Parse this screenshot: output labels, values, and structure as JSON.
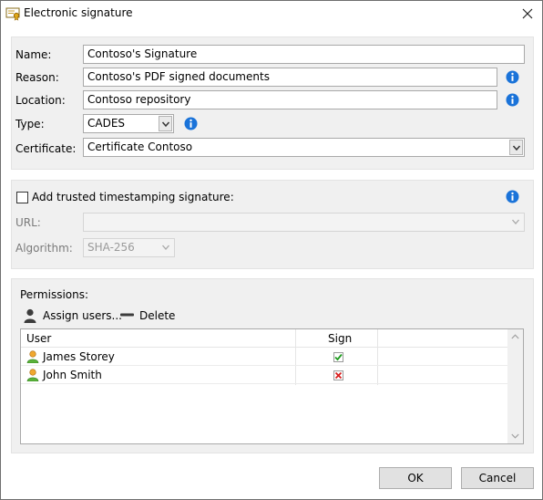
{
  "window": {
    "title": "Electronic signature",
    "title_icon": "certificate-icon",
    "close_icon": "close-icon"
  },
  "signature": {
    "name_label": "Name:",
    "name_value": "Contoso's Signature",
    "reason_label": "Reason:",
    "reason_value": "Contoso's PDF signed documents",
    "location_label": "Location:",
    "location_value": "Contoso repository",
    "type_label": "Type:",
    "type_value": "CADES",
    "certificate_label": "Certificate:",
    "certificate_value": "Certificate Contoso"
  },
  "timestamp": {
    "checkbox_label": "Add trusted timestamping signature:",
    "checked": false,
    "url_label": "URL:",
    "url_value": "",
    "algorithm_label": "Algorithm:",
    "algorithm_value": "SHA-256"
  },
  "permissions": {
    "label": "Permissions:",
    "assign_users_label": "Assign users...",
    "delete_label": "Delete",
    "columns": [
      "User",
      "Sign"
    ],
    "rows": [
      {
        "user": "James Storey",
        "sign": true
      },
      {
        "user": "John Smith",
        "sign": false
      }
    ]
  },
  "buttons": {
    "ok": "OK",
    "cancel": "Cancel"
  },
  "colors": {
    "info": "#1a73d9",
    "check": "#1e9b1e",
    "cross": "#d81e1e"
  }
}
